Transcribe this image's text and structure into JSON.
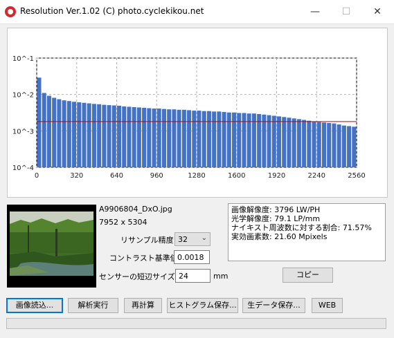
{
  "window": {
    "title": "Resolution Ver.1.02 (C) photo.cyclekikou.net",
    "minimize": "—",
    "maximize": "☐",
    "close": "✕"
  },
  "chart_data": {
    "type": "bar",
    "y_scale": "log",
    "ylim_exponents": [
      -4,
      -1
    ],
    "y_ticks": [
      "10^-1",
      "10^-2",
      "10^-3",
      "10^-4"
    ],
    "x_ticks": [
      "0",
      "320",
      "640",
      "960",
      "1280",
      "1600",
      "1920",
      "2240",
      "2560"
    ],
    "xlim": [
      0,
      2560
    ],
    "bar_color": "#4472c4",
    "threshold_color": "#c00000",
    "threshold": 0.0018,
    "grid": true,
    "bins": 64,
    "values": [
      0.029,
      0.011,
      0.0092,
      0.0081,
      0.0074,
      0.0069,
      0.0066,
      0.0063,
      0.0061,
      0.0059,
      0.0057,
      0.0055,
      0.0054,
      0.0052,
      0.0051,
      0.005,
      0.0049,
      0.0047,
      0.0046,
      0.0045,
      0.0044,
      0.0043,
      0.0042,
      0.0041,
      0.0041,
      0.004,
      0.0039,
      0.0039,
      0.0038,
      0.0038,
      0.0037,
      0.0036,
      0.0036,
      0.0035,
      0.0035,
      0.0034,
      0.0034,
      0.0033,
      0.0032,
      0.0032,
      0.0031,
      0.0031,
      0.003,
      0.003,
      0.0029,
      0.0028,
      0.0027,
      0.0026,
      0.0025,
      0.0024,
      0.0023,
      0.0022,
      0.0021,
      0.002,
      0.0019,
      0.0018,
      0.00175,
      0.0017,
      0.00165,
      0.0016,
      0.0015,
      0.0014,
      0.00135,
      0.0013
    ]
  },
  "file": {
    "name": "A9906804_DxO.jpg",
    "dimensions": "7952 x 5304"
  },
  "settings": {
    "resample_label": "リサンプル精度",
    "resample_value": "32",
    "contrast_label": "コントラスト基準値",
    "contrast_value": "0.0018",
    "sensor_label": "センサーの短辺サイズ",
    "sensor_value": "24",
    "sensor_unit": "mm"
  },
  "results": {
    "line1": "画像解像度: 3796 LW/PH",
    "line2": "光学解像度: 79.1 LP/mm",
    "line3": "ナイキスト周波数に対する割合: 71.57%",
    "line4": "実効画素数: 21.60 Mpixels"
  },
  "buttons": {
    "copy": "コピー",
    "load": "画像読込...",
    "analyze": "解析実行",
    "recalc": "再計算",
    "save_hist": "ヒストグラム保存...",
    "save_raw": "生データ保存...",
    "web": "WEB"
  }
}
